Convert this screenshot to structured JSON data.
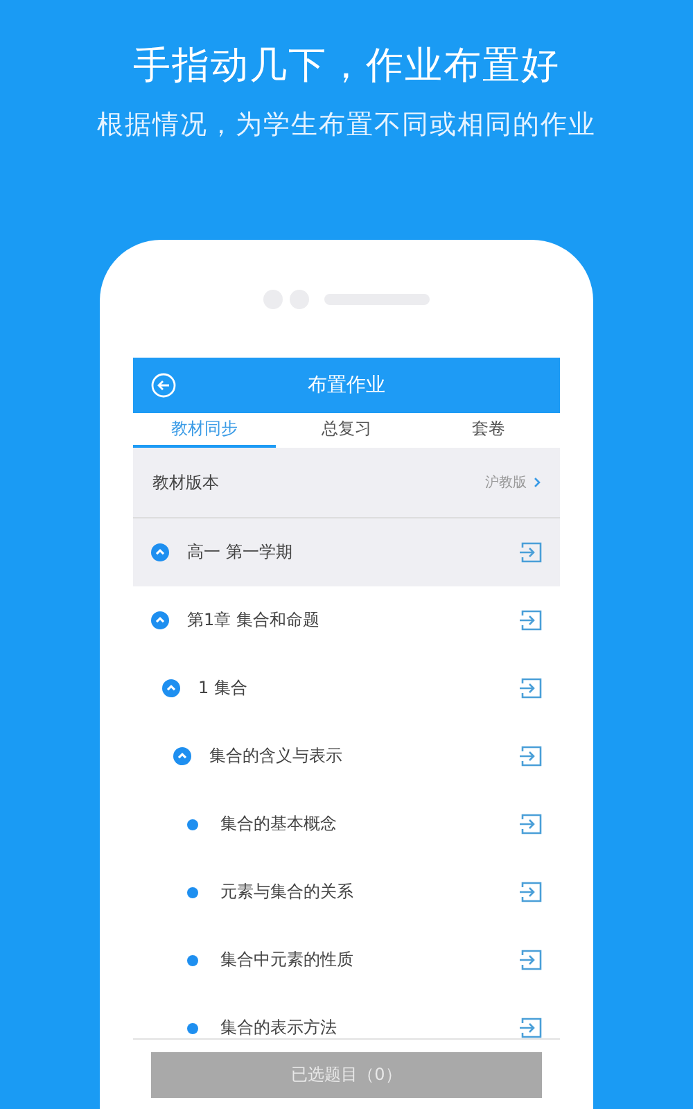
{
  "headline": "手指动几下，作业布置好",
  "subheadline": "根据情况，为学生布置不同或相同的作业",
  "app_bar": {
    "title": "布置作业"
  },
  "tabs": [
    {
      "label": "教材同步",
      "selected": true
    },
    {
      "label": "总复习",
      "selected": false
    },
    {
      "label": "套卷",
      "selected": false
    }
  ],
  "textbook_version": {
    "label": "教材版本",
    "value": "沪教版"
  },
  "tree": [
    {
      "label": "高一 第一学期",
      "expanded": true,
      "children": [
        {
          "label": "第1章 集合和命题",
          "expanded": true,
          "children": [
            {
              "label": "1 集合",
              "expanded": true,
              "children": [
                {
                  "label": "集合的含义与表示",
                  "expanded": true,
                  "children": [
                    {
                      "label": "集合的基本概念"
                    },
                    {
                      "label": "元素与集合的关系"
                    },
                    {
                      "label": "集合中元素的性质"
                    },
                    {
                      "label": "集合的表示方法"
                    }
                  ]
                }
              ]
            }
          ]
        }
      ]
    }
  ],
  "footer_button": {
    "label": "已选题目（0）",
    "disabled": true
  }
}
